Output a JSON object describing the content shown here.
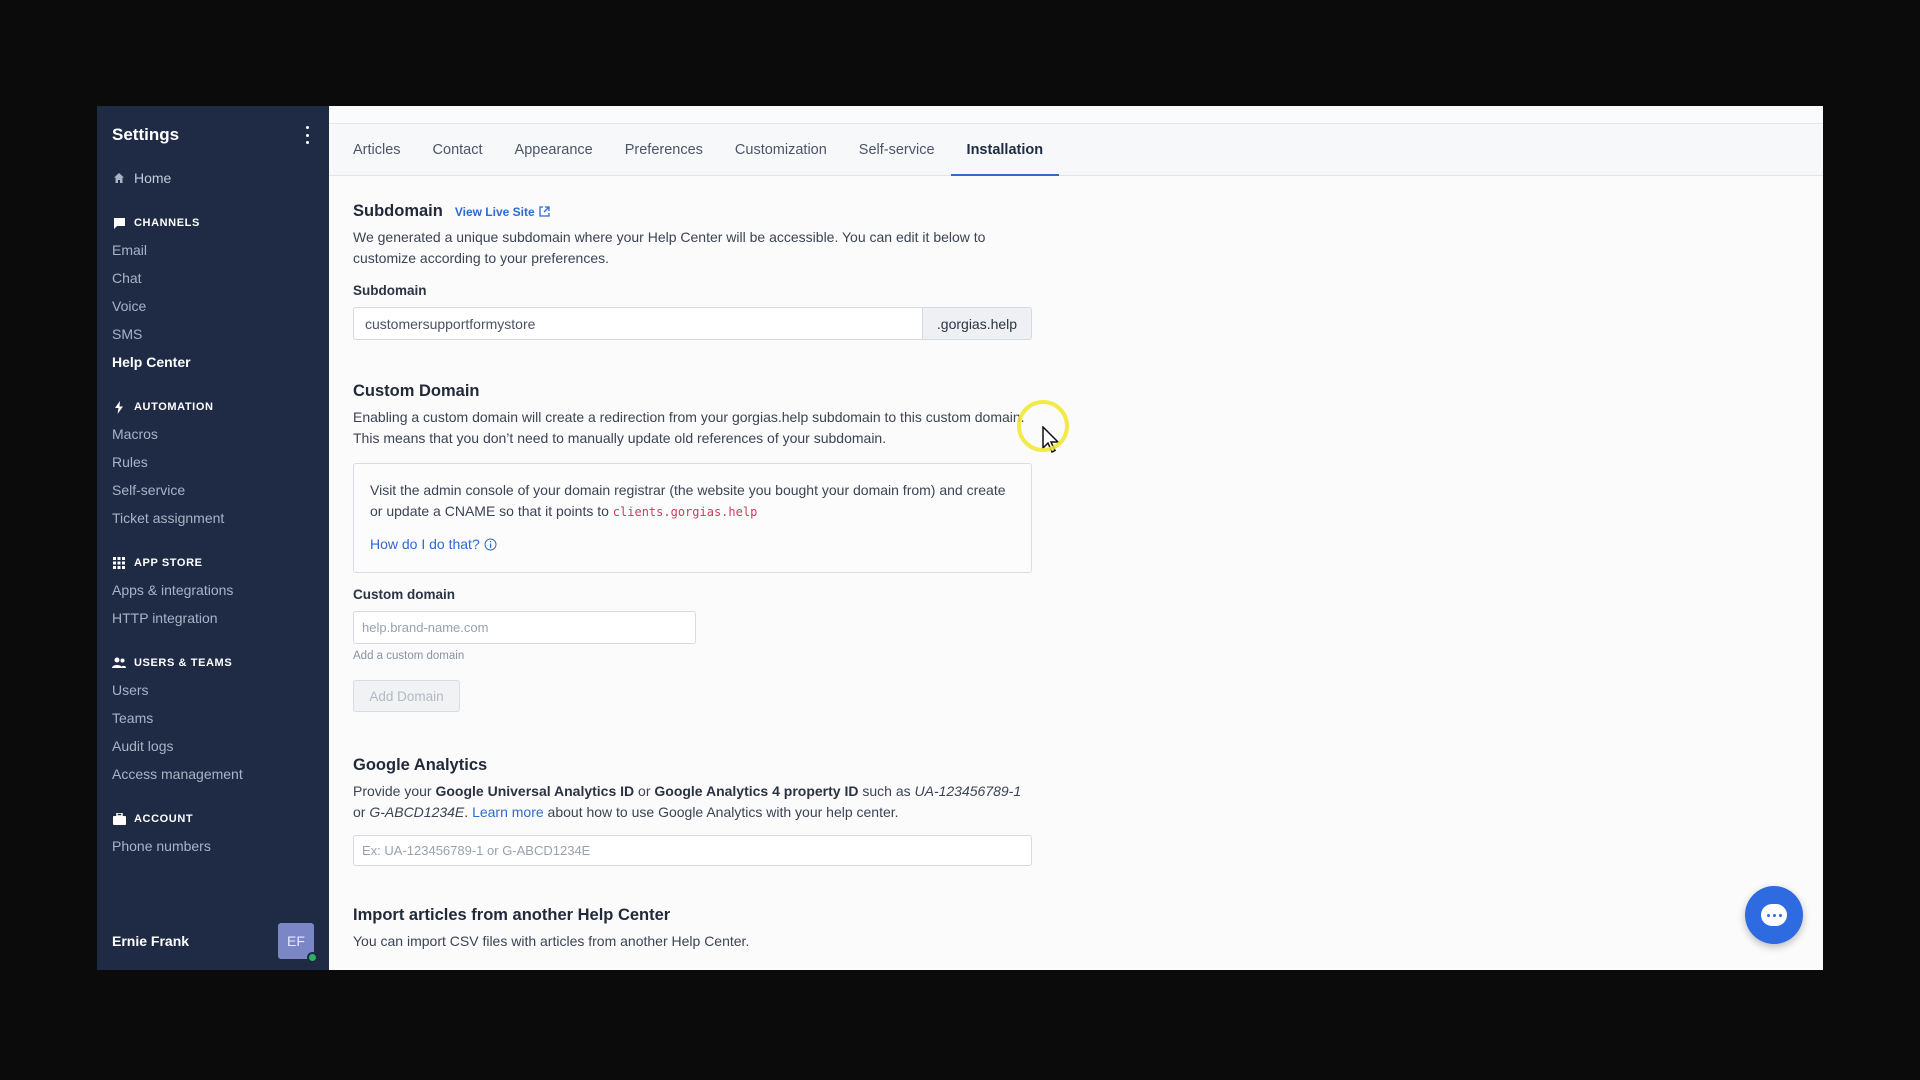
{
  "sidebar": {
    "title": "Settings",
    "home": "Home",
    "sections": [
      {
        "title": "CHANNELS",
        "items": [
          "Email",
          "Chat",
          "Voice",
          "SMS",
          "Help Center"
        ]
      },
      {
        "title": "AUTOMATION",
        "items": [
          "Macros",
          "Rules",
          "Self-service",
          "Ticket assignment"
        ]
      },
      {
        "title": "APP STORE",
        "items": [
          "Apps & integrations",
          "HTTP integration"
        ]
      },
      {
        "title": "USERS & TEAMS",
        "items": [
          "Users",
          "Teams",
          "Audit logs",
          "Access management"
        ]
      },
      {
        "title": "ACCOUNT",
        "items": [
          "Phone numbers"
        ]
      }
    ],
    "active_item": "Help Center",
    "user": {
      "name": "Ernie Frank",
      "initials": "EF",
      "status_color": "#27b35f"
    }
  },
  "tabs": [
    "Articles",
    "Contact",
    "Appearance",
    "Preferences",
    "Customization",
    "Self-service",
    "Installation"
  ],
  "active_tab": "Installation",
  "subdomain": {
    "heading": "Subdomain",
    "view_live_site": "View Live Site",
    "description": "We generated a unique subdomain where your Help Center will be accessible. You can edit it below to customize according to your preferences.",
    "field_label": "Subdomain",
    "value": "customersupportformystore",
    "suffix": ".gorgias.help"
  },
  "custom_domain": {
    "heading": "Custom Domain",
    "description": "Enabling a custom domain will create a redirection from your gorgias.help subdomain to this custom domain. This means that you don’t need to manually update old references of your subdomain.",
    "info_text": "Visit the admin console of your domain registrar (the website you bought your domain from) and create or update a CNAME so that it points to ",
    "info_code": "clients.gorgias.help",
    "howto": "How do I do that?",
    "field_label": "Custom domain",
    "placeholder": "help.brand-name.com",
    "hint": "Add a custom domain",
    "button": "Add Domain"
  },
  "google_analytics": {
    "heading": "Google Analytics",
    "text_1": "Provide your ",
    "bold_1": "Google Universal Analytics ID",
    "text_2": " or ",
    "bold_2": "Google Analytics 4 property ID",
    "text_3": " such as ",
    "italic_1": "UA-123456789-1",
    "text_4": " or ",
    "italic_2": "G-ABCD1234E",
    "text_5": ". ",
    "learn_more": "Learn more",
    "text_6": " about how to use Google Analytics with your help center.",
    "placeholder": "Ex: UA-123456789-1 or G-ABCD1234E"
  },
  "import": {
    "heading": "Import articles from another Help Center",
    "description": "You can import CSV files with articles from another Help Center."
  },
  "colors": {
    "sidebar_bg": "#1f2b45",
    "accent": "#2e6be0",
    "link": "#2d6ad1",
    "code": "#d33a5c"
  }
}
